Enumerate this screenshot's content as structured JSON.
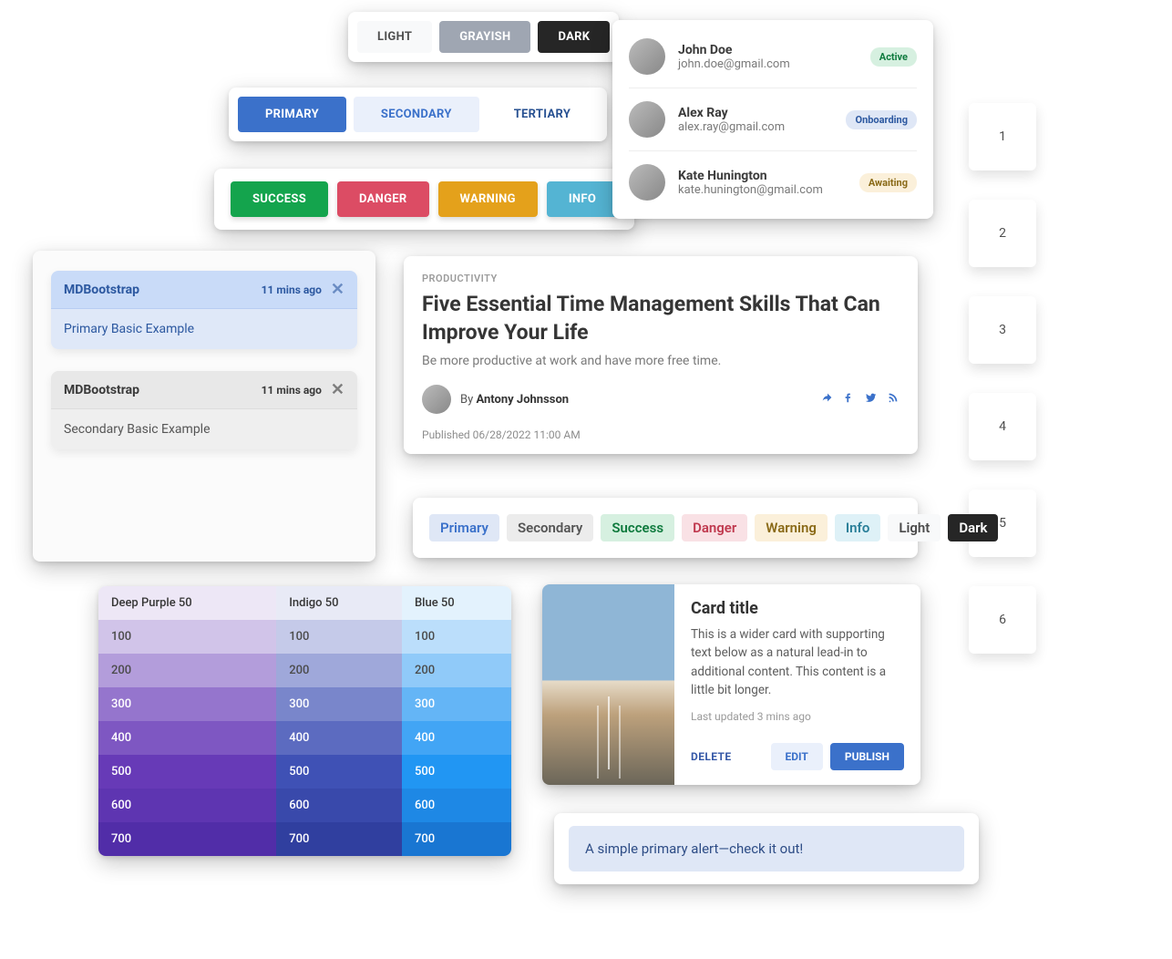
{
  "theme_buttons": {
    "light": "LIGHT",
    "grayish": "GRAYISH",
    "dark": "DARK"
  },
  "pill_tabs": {
    "primary": "PRIMARY",
    "secondary": "SECONDARY",
    "tertiary": "TERTIARY"
  },
  "status_buttons": {
    "success": "SUCCESS",
    "danger": "DANGER",
    "warning": "WARNING",
    "info": "INFO"
  },
  "users": [
    {
      "name": "John Doe",
      "email": "john.doe@gmail.com",
      "status": "Active"
    },
    {
      "name": "Alex Ray",
      "email": "alex.ray@gmail.com",
      "status": "Onboarding"
    },
    {
      "name": "Kate Hunington",
      "email": "kate.hunington@gmail.com",
      "status": "Awaiting"
    }
  ],
  "numbers": [
    "1",
    "2",
    "3",
    "4",
    "5",
    "6"
  ],
  "toasts": [
    {
      "title": "MDBootstrap",
      "time_ago": "11 mins ago",
      "body": "Primary Basic Example"
    },
    {
      "title": "MDBootstrap",
      "time_ago": "11 mins ago",
      "body": "Secondary Basic Example"
    }
  ],
  "article": {
    "kicker": "PRODUCTIVITY",
    "title": "Five Essential Time Management Skills That Can Improve Your Life",
    "subtitle": "Be more productive at work and have more free time.",
    "by_prefix": "By ",
    "author": "Antony Johnsson",
    "published": "Published 06/28/2022 11:00 AM"
  },
  "badges": {
    "primary": "Primary",
    "secondary": "Secondary",
    "success": "Success",
    "danger": "Danger",
    "warning": "Warning",
    "info": "Info",
    "light": "Light",
    "dark": "Dark"
  },
  "palette": {
    "columns": [
      "Deep Purple 50",
      "Indigo 50",
      "Blue 50"
    ],
    "rows": [
      "100",
      "200",
      "300",
      "400",
      "500",
      "600",
      "700"
    ],
    "colors": {
      "deep_purple": [
        "#d1c4e9",
        "#b39ddb",
        "#9575cd",
        "#7e57c2",
        "#673ab7",
        "#5e35b1",
        "#512da8"
      ],
      "indigo": [
        "#c5cae9",
        "#9fa8da",
        "#7986cb",
        "#5c6bc0",
        "#3f51b5",
        "#3949ab",
        "#303f9f"
      ],
      "blue": [
        "#bbdefb",
        "#90caf9",
        "#64b5f6",
        "#42a5f5",
        "#2196f3",
        "#1e88e5",
        "#1976d2"
      ]
    }
  },
  "hcard": {
    "title": "Card title",
    "body": "This is a wider card with supporting text below as a natural lead-in to additional content. This content is a little bit longer.",
    "updated": "Last updated 3 mins ago",
    "delete": "DELETE",
    "edit": "EDIT",
    "publish": "PUBLISH"
  },
  "alert": {
    "text": "A simple primary alert—check it out!"
  }
}
